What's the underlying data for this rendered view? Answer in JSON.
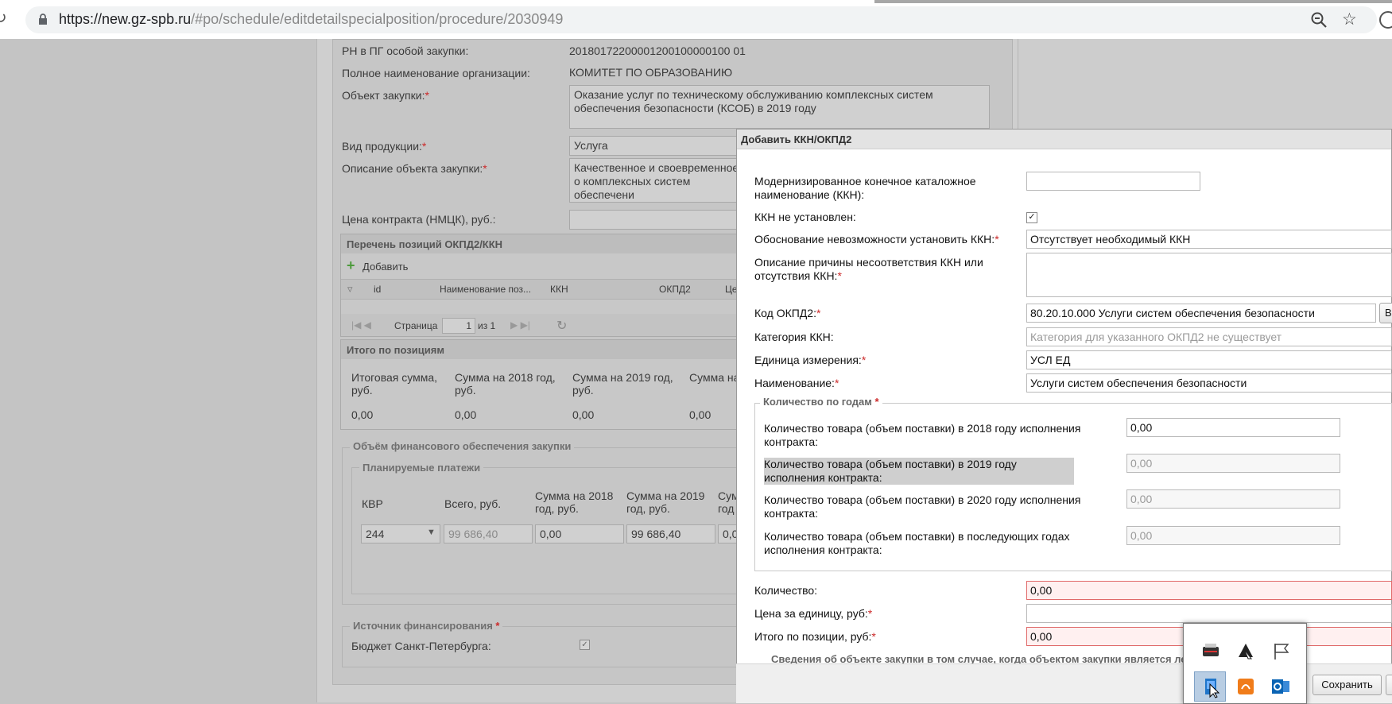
{
  "browser": {
    "url_host": "https://new.gz-spb.ru",
    "url_path": "/#po/schedule/editdetailspecialposition/procedure/2030949"
  },
  "form": {
    "rn_label": "РН в ПГ особой закупки:",
    "rn_value": "20180172200001200100000100 01",
    "org_label": "Полное наименование организации:",
    "org_value": "КОМИТЕТ ПО ОБРАЗОВАНИЮ",
    "object_label": "Объект закупки:",
    "object_value": "Оказание услуг по техническому обслуживанию комплексных систем обеспечения безопасности (КСОБ) в 2019 году",
    "product_type_label": "Вид продукции:",
    "product_type_value": "Услуга",
    "description_label": "Описание объекта закупки:",
    "description_value": "Качественное и своевременное о комплексных систем обеспечени",
    "price_label": "Цена контракта (НМЦК), руб.:",
    "positions_panel_title": "Перечень позиций ОКПД2/ККН",
    "add_label": "Добавить",
    "grid_columns": [
      "id",
      "Наименование поз...",
      "ККН",
      "ОКПД2",
      "Це"
    ],
    "pager_page_label": "Страница",
    "pager_page_value": "1",
    "pager_of": "из 1",
    "totals_title": "Итого по позициям",
    "totals_headers": [
      "Итоговая сумма, руб.",
      "Сумма на 2018 год, руб.",
      "Сумма на 2019 год, руб.",
      "Сумма на"
    ],
    "totals_values": [
      "0,00",
      "0,00",
      "0,00",
      "0,00"
    ],
    "finance_title": "Объём финансового обеспечения закупки",
    "payments_title": "Планируемые платежи",
    "payments_headers": [
      "КВР",
      "Всего, руб.",
      "Сумма на 2018 год, руб.",
      "Сумма на 2019 год, руб.",
      "Сум год"
    ],
    "payments_kvr": "244",
    "payments_total": "99 686,40",
    "payments_2018": "0,00",
    "payments_2019": "99 686,40",
    "payments_next": "0,0",
    "source_title": "Источник финансирования",
    "budget_label": "Бюджет Санкт-Петербурга:",
    "required_mark": "*"
  },
  "dialog": {
    "title": "Добавить ККН/ОКПД2",
    "kkn_label": "Модернизированное конечное каталожное наименование (ККН):",
    "kkn_value": "",
    "kkn_not_set_label": "ККН не установлен:",
    "kkn_not_set_checked": true,
    "justification_label": "Обоснование невозможности установить ККН:",
    "justification_value": "Отсутствует необходимый ККН",
    "reason_label": "Описание причины несоответствия ККН или отсутствия ККН:",
    "reason_value": "",
    "okpd_label": "Код ОКПД2:",
    "okpd_value": "80.20.10.000 Услуги систем обеспечения безопасности",
    "okpd_button": "Вы",
    "category_label": "Категория ККН:",
    "category_placeholder": "Категория для указанного ОКПД2 не существует",
    "unit_label": "Единица измерения:",
    "unit_value": "УСЛ ЕД",
    "name_label": "Наименование:",
    "name_value": "Услуги систем обеспечения безопасности",
    "years_title": "Количество по годам",
    "years": [
      {
        "label": "Количество товара (объем поставки) в 2018 году исполнения контракта:",
        "value": "0,00",
        "disabled": false
      },
      {
        "label": "Количество товара (объем поставки) в 2019 году исполнения контракта:",
        "value": "0,00",
        "disabled": true
      },
      {
        "label": "Количество товара (объем поставки) в 2020 году исполнения контракта:",
        "value": "0,00",
        "disabled": true
      },
      {
        "label": "Количество товара (объем поставки) в последующих годах исполнения контракта:",
        "value": "0,00",
        "disabled": true
      }
    ],
    "quantity_label": "Количество:",
    "quantity_value": "0,00",
    "unit_price_label": "Цена за единицу, руб:",
    "unit_price_value": "",
    "total_label": "Итого по позиции, руб:",
    "total_value": "0,00",
    "info_note": "Сведения об объекте закупки в том случае, когда объектом закупки является ле",
    "save_button": "Сохранить"
  },
  "tray_icons": [
    "printer-app-icon",
    "cursor-app-icon",
    "flag-icon",
    "screen-app-icon",
    "orange-app-icon",
    "outlook-icon"
  ]
}
